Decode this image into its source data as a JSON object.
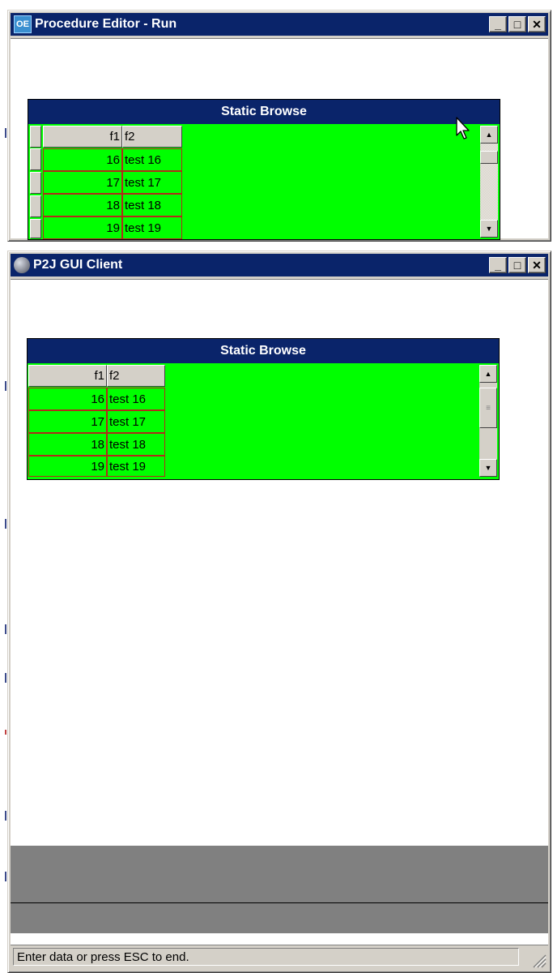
{
  "window_top": {
    "title": "Procedure Editor - Run",
    "icon_label": "OE",
    "browse": {
      "title": "Static Browse",
      "columns": [
        "f1",
        "f2"
      ],
      "rows": [
        {
          "f1": "16",
          "f2": "test 16"
        },
        {
          "f1": "17",
          "f2": "test 17"
        },
        {
          "f1": "18",
          "f2": "test 18"
        },
        {
          "f1": "19",
          "f2": "test 19"
        }
      ],
      "background_color": "#00ff00",
      "header_color": "#0a246a"
    }
  },
  "window_bottom": {
    "title": "P2J GUI Client",
    "browse": {
      "title": "Static Browse",
      "columns": [
        "f1",
        "f2"
      ],
      "rows": [
        {
          "f1": "16",
          "f2": "test 16"
        },
        {
          "f1": "17",
          "f2": "test 17"
        },
        {
          "f1": "18",
          "f2": "test 18"
        },
        {
          "f1": "19",
          "f2": "test 19"
        }
      ],
      "background_color": "#00ff00"
    },
    "status_text": "Enter data or press ESC to end."
  },
  "title_controls": {
    "minimize": "_",
    "maximize": "□",
    "close": "✕"
  },
  "icons": {
    "scroll_up": "▲",
    "scroll_down": "▼",
    "thumb_grip": "≡",
    "app_icon_bottom": "globe-icon",
    "resize_grip": "size-grip-icon",
    "cursor": "mouse-pointer-icon"
  }
}
